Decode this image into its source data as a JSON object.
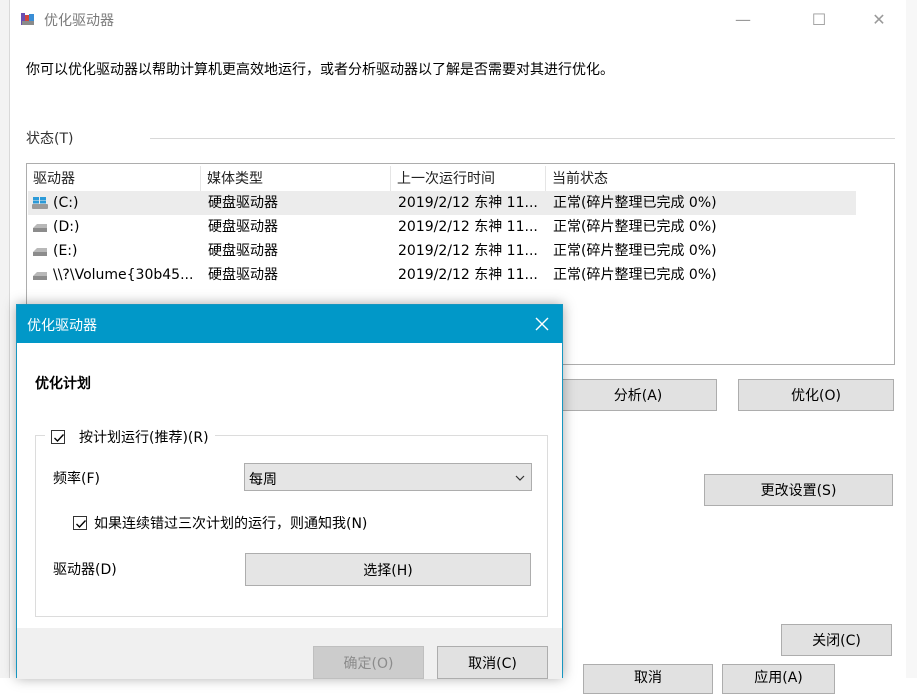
{
  "main": {
    "title": "优化驱动器",
    "window_controls": {
      "minimize": "—",
      "maximize": "☐",
      "close": "✕"
    },
    "description": "你可以优化驱动器以帮助计算机更高效地运行，或者分析驱动器以了解是否需要对其进行优化。",
    "status_label": "状态(T)",
    "columns": [
      "驱动器",
      "媒体类型",
      "上一次运行时间",
      "当前状态"
    ],
    "drives": [
      {
        "name": "(C:)",
        "media": "硬盘驱动器",
        "last_run": "2019/2/12 东神 11...",
        "status": "正常(碎片整理已完成 0%)"
      },
      {
        "name": "(D:)",
        "media": "硬盘驱动器",
        "last_run": "2019/2/12 东神 11...",
        "status": "正常(碎片整理已完成 0%)"
      },
      {
        "name": "(E:)",
        "media": "硬盘驱动器",
        "last_run": "2019/2/12 东神 11...",
        "status": "正常(碎片整理已完成 0%)"
      },
      {
        "name": "\\\\?\\Volume{30b45...",
        "media": "硬盘驱动器",
        "last_run": "2019/2/12 东神 11...",
        "status": "正常(碎片整理已完成 0%)"
      }
    ],
    "analyze_label": "分析(A)",
    "optimize_label": "优化(O)",
    "change_settings_label": "更改设置(S)",
    "close_label": "关闭(C)",
    "partial_buttons": [
      "取消",
      "应用(A)"
    ]
  },
  "dialog": {
    "title": "优化驱动器",
    "section_title": "优化计划",
    "run_on_schedule_label": "按计划运行(推荐)(R)",
    "run_on_schedule_checked": true,
    "frequency_label": "频率(F)",
    "frequency_value": "每周",
    "notify_label": "如果连续错过三次计划的运行，则通知我(N)",
    "notify_checked": true,
    "drives_label": "驱动器(D)",
    "choose_label": "选择(H)",
    "ok_label": "确定(O)",
    "cancel_label": "取消(C)"
  },
  "colors": {
    "dialog_title_bar": "#0198c8",
    "selected_row": "#ececec",
    "button_face": "#e1e1e1"
  }
}
